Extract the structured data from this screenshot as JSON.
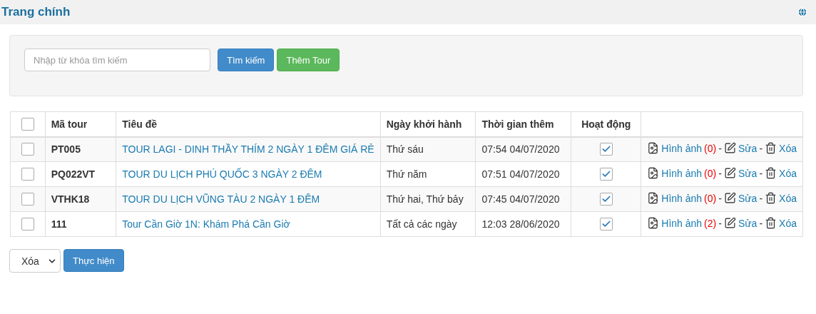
{
  "header": {
    "title": "Trang chính"
  },
  "search": {
    "placeholder": "Nhập từ khóa tìm kiếm",
    "buttons": [
      {
        "kind": "primary",
        "label": "Tìm kiếm"
      },
      {
        "kind": "success",
        "label": "Thêm Tour"
      }
    ]
  },
  "table": {
    "select_all": {
      "checked": false
    },
    "columns": [
      "Mã tour",
      "Tiêu đề",
      "Ngày khởi hành",
      "Thời gian thêm",
      "Hoạt động"
    ],
    "rows": [
      {
        "checked": false,
        "code": "PT005",
        "title": "TOUR LAGI - DINH THẦY THÍM 2 NGÀY 1 ĐÊM GIÁ RẺ",
        "departure": "Thứ sáu",
        "added": "07:54 04/07/2020",
        "active": true,
        "actions": [
          {
            "kind": "images",
            "label": "Hình ảnh",
            "count": "(0)"
          },
          {
            "kind": "separator",
            "label": "-"
          },
          {
            "kind": "edit",
            "label": "Sửa"
          },
          {
            "kind": "separator",
            "label": "-"
          },
          {
            "kind": "delete",
            "label": "Xóa"
          }
        ]
      },
      {
        "checked": false,
        "code": "PQ022VT",
        "title": "TOUR DU LỊCH PHÚ QUỐC 3 NGÀY 2 ĐÊM",
        "departure": "Thứ năm",
        "added": "07:51 04/07/2020",
        "active": true,
        "actions": [
          {
            "kind": "images",
            "label": "Hình ảnh",
            "count": "(0)"
          },
          {
            "kind": "separator",
            "label": "-"
          },
          {
            "kind": "edit",
            "label": "Sửa"
          },
          {
            "kind": "separator",
            "label": "-"
          },
          {
            "kind": "delete",
            "label": "Xóa"
          }
        ]
      },
      {
        "checked": false,
        "code": "VTHK18",
        "title": "TOUR DU LỊCH VŨNG TÀU 2 NGÀY 1 ĐÊM",
        "departure": "Thứ hai, Thứ bảy",
        "added": "07:45 04/07/2020",
        "active": true,
        "actions": [
          {
            "kind": "images",
            "label": "Hình ảnh",
            "count": "(0)"
          },
          {
            "kind": "separator",
            "label": "-"
          },
          {
            "kind": "edit",
            "label": "Sửa"
          },
          {
            "kind": "separator",
            "label": "-"
          },
          {
            "kind": "delete",
            "label": "Xóa"
          }
        ]
      },
      {
        "checked": false,
        "code": "111",
        "title": "Tour Cần Giờ 1N: Khám Phá Cần Giờ",
        "departure": "Tất cả các ngày",
        "added": "12:03 28/06/2020",
        "active": true,
        "actions": [
          {
            "kind": "images",
            "label": "Hình ảnh",
            "count": "(2)"
          },
          {
            "kind": "separator",
            "label": "-"
          },
          {
            "kind": "edit",
            "label": "Sửa"
          },
          {
            "kind": "separator",
            "label": "-"
          },
          {
            "kind": "delete",
            "label": "Xóa"
          }
        ]
      }
    ]
  },
  "bulk": {
    "action": "Xóa",
    "button": "Thực hiện"
  }
}
